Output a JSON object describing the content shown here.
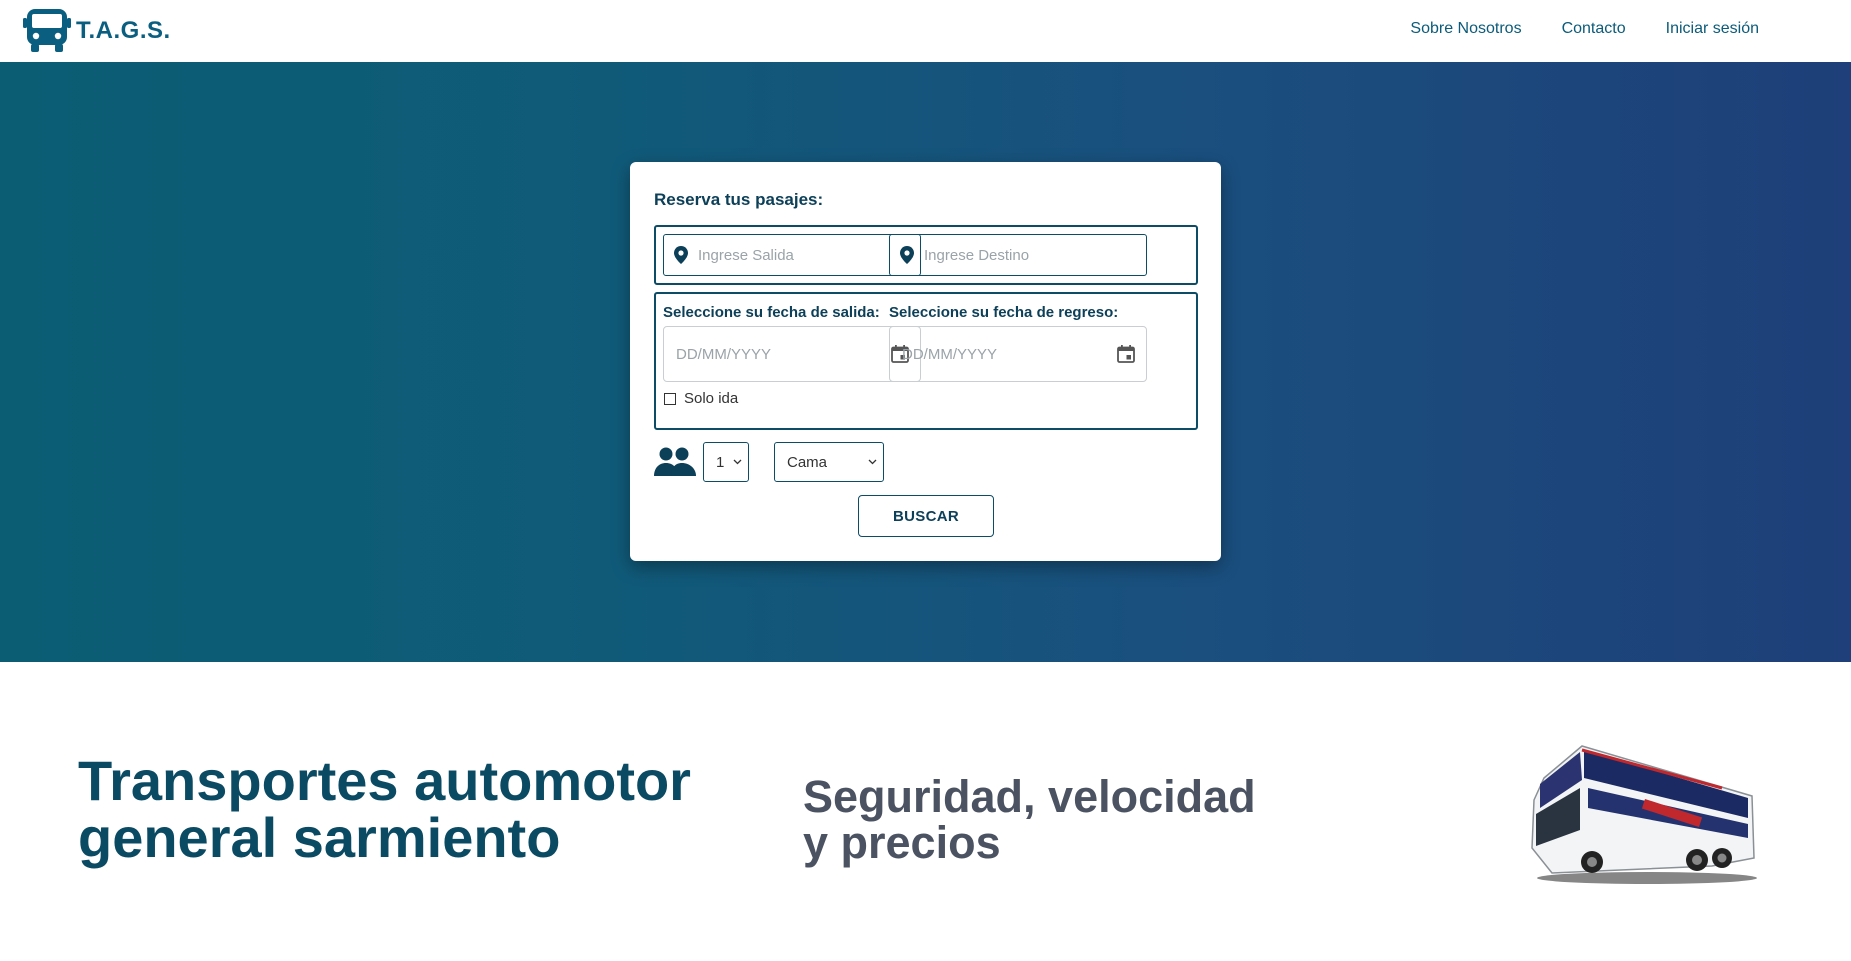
{
  "brand": {
    "name": "T.A.G.S.",
    "icon": "bus-icon",
    "color": "#0a5f80"
  },
  "nav": {
    "links": [
      "Sobre Nosotros",
      "Contacto",
      "Iniciar sesión"
    ]
  },
  "booking": {
    "title": "Reserva tus pasajes:",
    "origin_placeholder": "Ingrese Salida",
    "destination_placeholder": "Ingrese Destino",
    "departure_label": "Seleccione su fecha de salida:",
    "return_label": "Seleccione su fecha de regreso:",
    "date_placeholder": "DD/MM/YYYY",
    "one_way_label": "Solo ida",
    "one_way_checked": false,
    "passengers": "1",
    "seat_type": "Cama",
    "search_label": "BUSCAR"
  },
  "hero": {
    "colors": [
      "#0a5d73",
      "#1e3f79"
    ]
  },
  "headline": {
    "line1": "Transportes automotor",
    "line2": "general sarmiento"
  },
  "tagline": {
    "line1": "Seguridad, velocidad",
    "line2": "y precios"
  }
}
